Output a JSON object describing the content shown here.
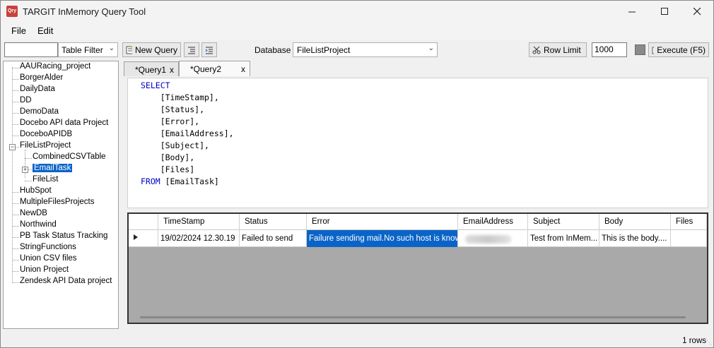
{
  "window": {
    "title": "TARGIT InMemory Query Tool",
    "icon_label": "Qry",
    "minimize_icon": "minimize-icon",
    "maximize_icon": "maximize-icon",
    "close_icon": "close-icon"
  },
  "menu": {
    "file": "File",
    "edit": "Edit"
  },
  "toolbar": {
    "table_filter_value": "",
    "table_filter_label": "Table Filter",
    "new_query_label": "New Query",
    "database_label": "Database",
    "database_value": "FileListProject",
    "row_limit_label": "Row Limit",
    "row_limit_value": "1000",
    "execute_label": "Execute (F5)"
  },
  "tree": {
    "items": [
      {
        "label": "AAURacing_project",
        "level": 0
      },
      {
        "label": "BorgerAlder",
        "level": 0
      },
      {
        "label": "DailyData",
        "level": 0
      },
      {
        "label": "DD",
        "level": 0
      },
      {
        "label": "DemoData",
        "level": 0
      },
      {
        "label": "Docebo API data Project",
        "level": 0
      },
      {
        "label": "DoceboAPIDB",
        "level": 0
      },
      {
        "label": "FileListProject",
        "level": 0,
        "expanded": true
      },
      {
        "label": "CombinedCSVTable",
        "level": 1
      },
      {
        "label": "EmailTask",
        "level": 1,
        "selected": true
      },
      {
        "label": "FileList",
        "level": 1
      },
      {
        "label": "HubSpot",
        "level": 0
      },
      {
        "label": "MultipleFilesProjects",
        "level": 0
      },
      {
        "label": "NewDB",
        "level": 0
      },
      {
        "label": "Northwind",
        "level": 0
      },
      {
        "label": "PB Task Status Tracking",
        "level": 0
      },
      {
        "label": "StringFunctions",
        "level": 0
      },
      {
        "label": "Union CSV files",
        "level": 0
      },
      {
        "label": "Union Project",
        "level": 0
      },
      {
        "label": "Zendesk API Data project",
        "level": 0
      }
    ]
  },
  "tabs": [
    {
      "label": "*Query1",
      "close": "x",
      "active": false
    },
    {
      "label": "*Query2",
      "close": "x",
      "active": true
    }
  ],
  "editor": {
    "lines": [
      {
        "kw": "SELECT",
        "text": ""
      },
      {
        "kw": "",
        "text": "    [TimeStamp],"
      },
      {
        "kw": "",
        "text": "    [Status],"
      },
      {
        "kw": "",
        "text": "    [Error],"
      },
      {
        "kw": "",
        "text": "    [EmailAddress],"
      },
      {
        "kw": "",
        "text": "    [Subject],"
      },
      {
        "kw": "",
        "text": "    [Body],"
      },
      {
        "kw": "",
        "text": "    [Files]"
      },
      {
        "kw": "FROM",
        "text": " [EmailTask]"
      }
    ]
  },
  "grid": {
    "columns": [
      "TimeStamp",
      "Status",
      "Error",
      "EmailAddress",
      "Subject",
      "Body",
      "Files"
    ],
    "rows": [
      {
        "TimeStamp": "19/02/2024 12.30.19",
        "Status": "Failed to send",
        "Error": "Failure sending mail.No such host is known.",
        "EmailAddress": "",
        "Subject": "Test from InMem...",
        "Body": "This is the body....",
        "Files": ""
      }
    ]
  },
  "status": {
    "rows": "1 rows"
  }
}
